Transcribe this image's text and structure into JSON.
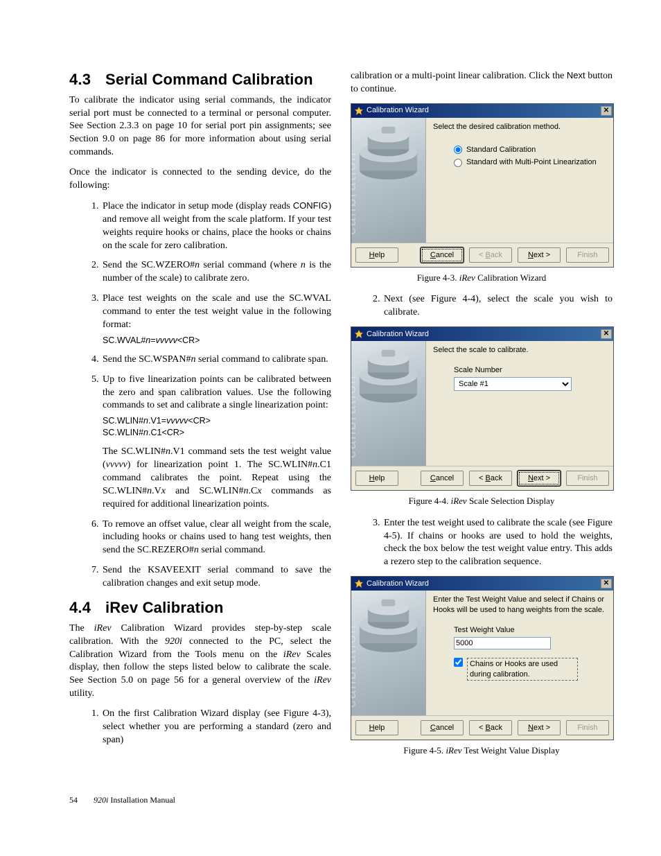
{
  "section43": {
    "num": "4.3",
    "title": "Serial Command Calibration",
    "intro1": "To calibrate the indicator using serial commands, the indicator serial port must be connected to a terminal or personal computer. See Section 2.3.3 on page 10 for serial port pin assignments; see Section 9.0 on page 86 for more information about using serial commands.",
    "intro2": "Once the indicator is connected to the sending device, do the following:",
    "steps": {
      "s1a": "Place the indicator in setup mode (display reads ",
      "s1b": "CONFIG",
      "s1c": ") and remove all weight from the scale platform. If your test weights require hooks or chains, place the hooks or chains on the scale for zero calibration.",
      "s2a": "Send the SC.WZERO#",
      "s2n": "n",
      "s2b": " serial command (where ",
      "s2c": " is the number of the scale) to calibrate zero.",
      "s3": "Place test weights on the scale and use the SC.WVAL command to enter the test weight value in the following format:",
      "s3cmd_a": "SC.WVAL#",
      "s3cmd_b": "n",
      "s3cmd_c": "=",
      "s3cmd_d": "vvvvv",
      "s3cmd_e": "<CR>",
      "s4a": "Send the SC.WSPAN#",
      "s4b": " serial command to calibrate span.",
      "s5": "Up to five linearization points can be calibrated between the zero and span calibration values. Use the following commands to set and calibrate a single linearization point:",
      "s5cmd1_a": "SC.WLIN#",
      "s5cmd1_b": "n",
      "s5cmd1_c": ".V1=",
      "s5cmd1_d": "vvvvv",
      "s5cmd1_e": "<CR>",
      "s5cmd2_a": "SC.WLIN#",
      "s5cmd2_b": "n",
      "s5cmd2_c": ".C1<CR>",
      "s5p2a": "The SC.WLIN#",
      "s5p2b": ".V1 command sets the test weight value (",
      "s5p2c": "vvvvv",
      "s5p2d": ") for linearization point 1. The SC.WLIN#",
      "s5p2e": ".C1 command calibrates the point. Repeat using the SC.WLIN#",
      "s5p2f": ".V",
      "s5p2g": "x",
      "s5p2h": " and SC.WLIN#",
      "s5p2i": ".C",
      "s5p2j": "x",
      "s5p2k": " commands as required for additional linearization points.",
      "s6a": "To remove an offset value, clear all weight from the scale, including hooks or chains used to hang test weights, then send the SC.REZERO#",
      "s6b": " serial command.",
      "s7": "Send the KSAVEEXIT serial command to save the calibration changes and exit setup mode."
    }
  },
  "section44": {
    "num": "4.4",
    "title": "iRev Calibration",
    "intro_a": "The ",
    "intro_irev": "iRev",
    "intro_b": " Calibration Wizard provides step-by-step scale calibration. With the ",
    "intro_920i": "920i",
    "intro_c": " connected to the PC, select the Calibration Wizard from the Tools menu on the ",
    "intro_d": " Scales display, then follow the steps listed below to calibrate the scale. See Section 5.0 on page 56 for a general overview of the ",
    "intro_e": " utility.",
    "step1": "On the first Calibration Wizard display (see Figure 4-3), select whether you are performing a standard (zero and span)",
    "right_intro_a": "calibration or a multi-point linear calibration. Click the ",
    "right_intro_next": "Next",
    "right_intro_b": " button to continue.",
    "step2": "Next (see Figure 4-4), select the scale you wish to calibrate.",
    "step3": "Enter the test weight used to calibrate the scale (see Figure 4-5). If chains or hooks are used to hold the weights, check the box below the test weight value entry. This adds a rezero step to the calibration sequence."
  },
  "wizard_common": {
    "title": "Calibration Wizard",
    "help": "Help",
    "cancel": "Cancel",
    "back": "< Back",
    "next": "Next >",
    "finish": "Finish"
  },
  "wizard1": {
    "prompt": "Select the desired calibration method.",
    "opt1": "Standard Calibration",
    "opt2": "Standard with Multi-Point Linearization"
  },
  "wizard2": {
    "prompt": "Select the scale to calibrate.",
    "label": "Scale Number",
    "selected": "Scale #1"
  },
  "wizard3": {
    "prompt": "Enter the Test Weight Value and select if Chains or Hooks will be used to hang weights from the scale.",
    "label": "Test Weight Value",
    "value": "5000",
    "checkbox": "Chains or Hooks are used during calibration."
  },
  "captions": {
    "fig43_label": "Figure 4-3. ",
    "fig43_ital": "iRev",
    "fig43_rest": " Calibration Wizard",
    "fig44_label": "Figure 4-4. ",
    "fig44_ital": "iRev",
    "fig44_rest": " Scale Selection Display",
    "fig45_label": "Figure 4-5. ",
    "fig45_ital": "iRev",
    "fig45_rest": " Test Weight Value Display"
  },
  "footer": {
    "page": "54",
    "title_ital": "920i",
    "title_rest": " Installation Manual"
  }
}
